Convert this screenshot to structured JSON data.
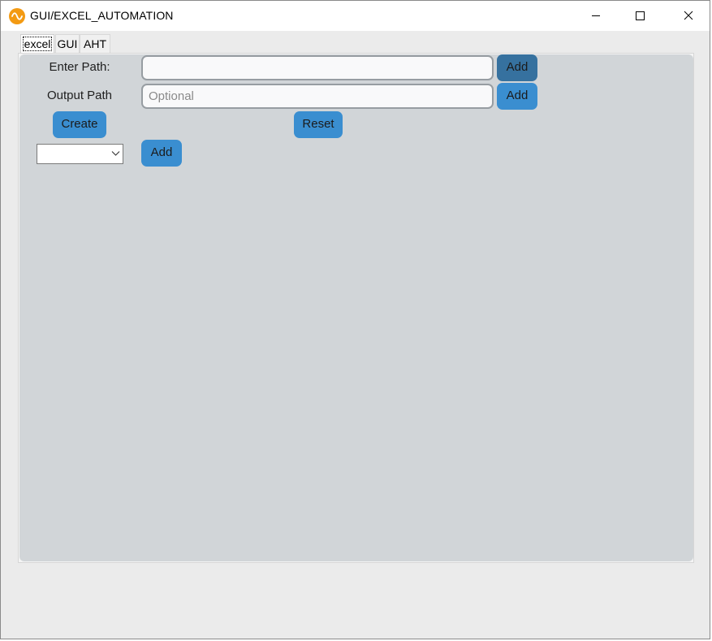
{
  "window": {
    "title": "GUI/EXCEL_AUTOMATION",
    "icon": "app-sine-wave-icon",
    "controls": [
      "minimize-icon",
      "maximize-icon",
      "close-icon"
    ]
  },
  "tabs": [
    {
      "label": "excel",
      "active": true
    },
    {
      "label": "GUI",
      "active": false
    },
    {
      "label": "AHT",
      "active": false
    }
  ],
  "form": {
    "enter_path_label": "Enter Path:",
    "enter_path_value": "",
    "enter_path_placeholder": "",
    "add_button_1": "Add",
    "output_path_label": "Output Path",
    "output_path_value": "",
    "output_path_placeholder": "Optional",
    "add_button_2": "Add",
    "create_button": "Create",
    "reset_button": "Reset",
    "dropdown_value": "",
    "add_button_3": "Add"
  },
  "colors": {
    "accent": "#3a8ed0",
    "accent_hover": "#36719f",
    "panel": "#d1d5d8",
    "app_icon": "#f39a12"
  }
}
